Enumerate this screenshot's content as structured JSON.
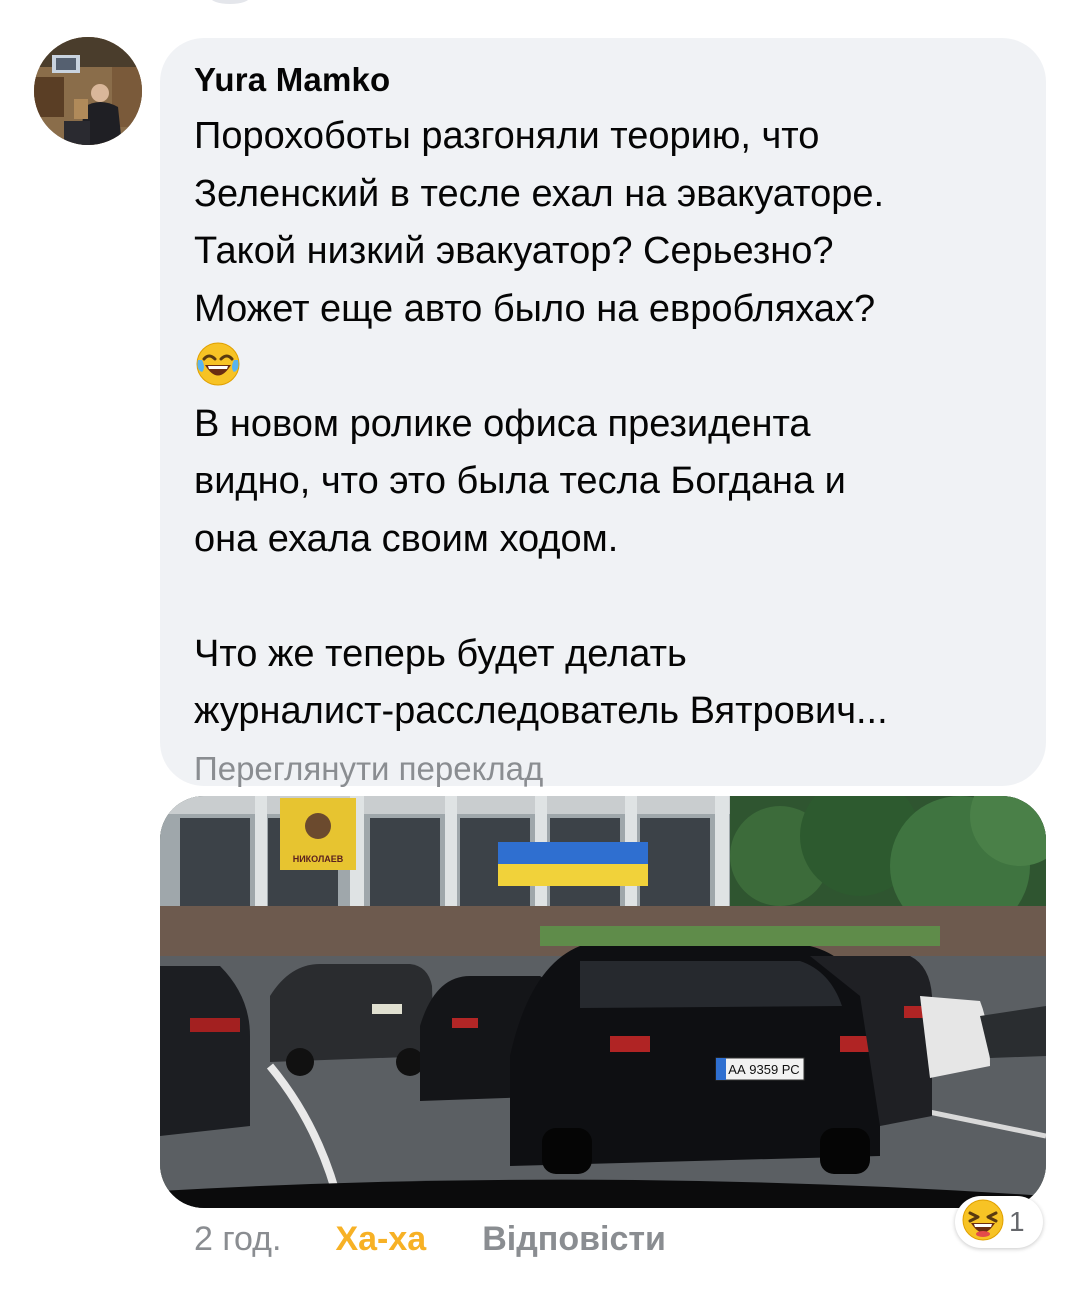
{
  "comment": {
    "author": "Yura  Mamko",
    "lines_before_emoji": "Порохоботы разгоняли теорию, что\nЗеленский в тесле ехал на эвакуаторе.\nТакой низкий эвакуатор? Серьезно?\nМожет еще авто было на евробляхах?",
    "emoji_icon": "tears-of-joy-emoji",
    "lines_after_emoji": "В новом ролике офиса президента\nвидно, что это была тесла Богдана и\nона ехала своим ходом.\n\nЧто же теперь будет делать\nжурналист-расследователь Вятрович...",
    "translate_link": "Переглянути переклад"
  },
  "photo": {
    "description_icon": "photo-attachment",
    "banner_text": "НИКОЛАЕВ",
    "license_plate": "АА 9359 РС"
  },
  "actions": {
    "time": "2 год.",
    "reaction_label": "Ха-ха",
    "reply_label": "Відповісти"
  },
  "reactions": {
    "icon": "haha-reaction-icon",
    "count": "1"
  },
  "colors": {
    "bubble": "#f0f2f5",
    "haha": "#f7b125",
    "muted": "#8a8d91"
  }
}
